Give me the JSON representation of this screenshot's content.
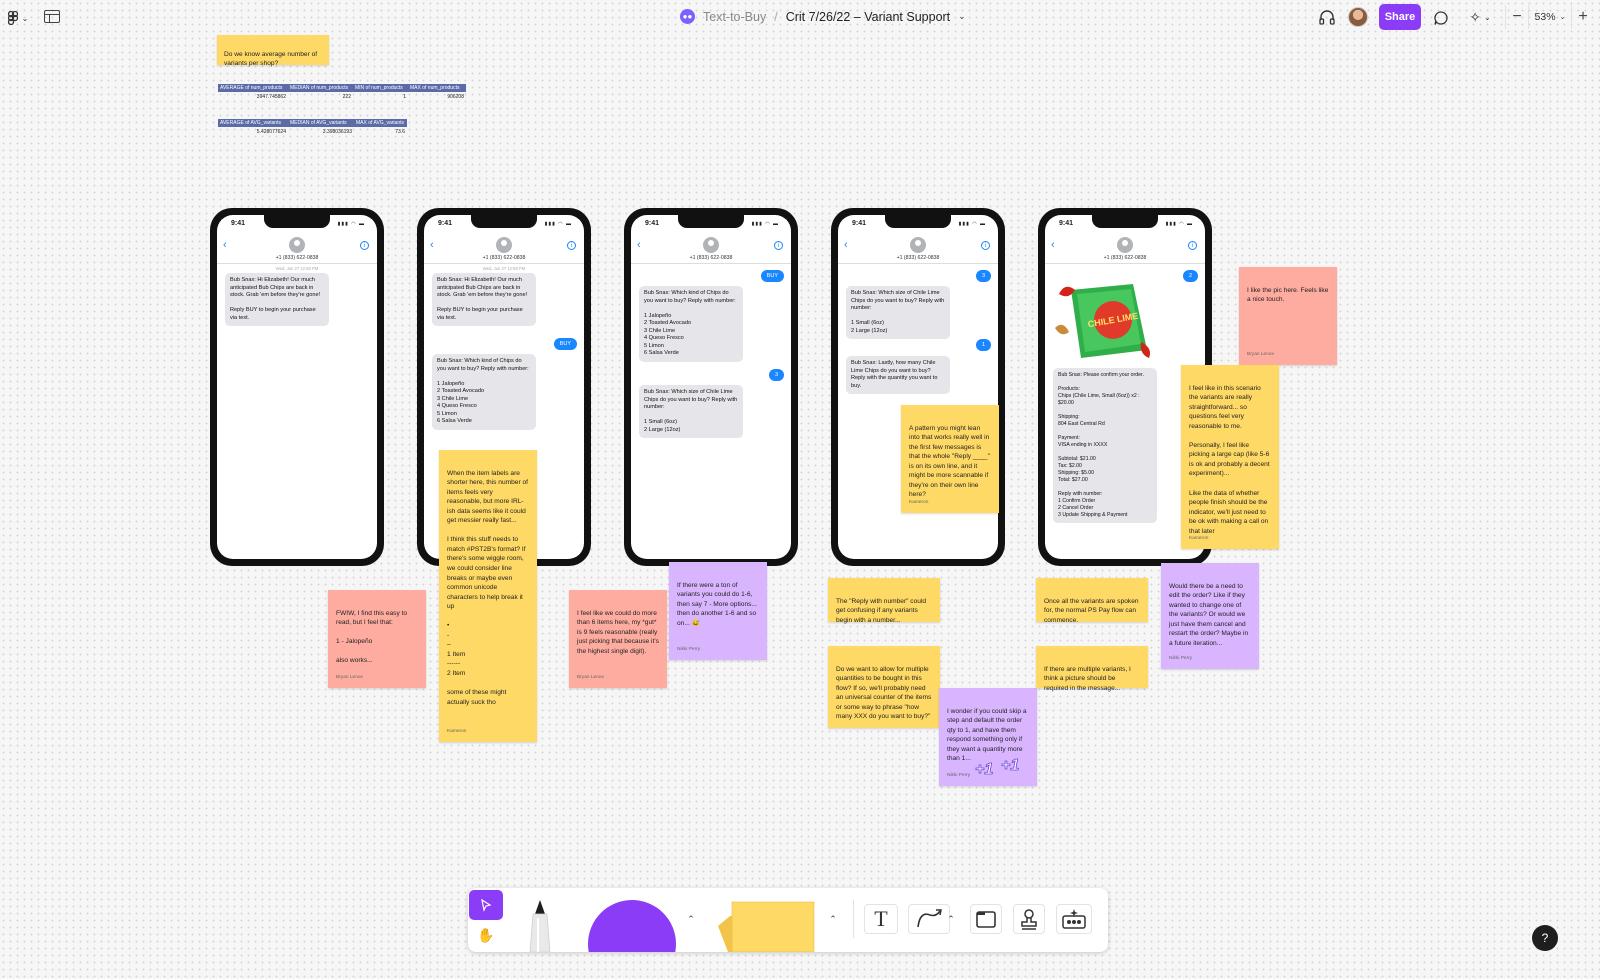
{
  "topbar": {
    "team": "Text-to-Buy",
    "separator": "/",
    "file": "Crit 7/26/22 – Variant Support",
    "share": "Share",
    "zoom": "53%",
    "zoom_minus": "−",
    "zoom_plus": "+"
  },
  "notes": {
    "question": "Do we know average number of variants per shop?",
    "fwiw": "FWIW, I find this easy to read, but I feel that:\n\n1 - Jalopeño\n\nalso works...",
    "fwiw_author": "Bryan Lenox",
    "labels_shorter": "When the item labels are shorter here, this number of items feels very reasonable, but more IRL-ish data seems like it could get messier really fast...\n\nI think this stuff needs to match #PST2B's format? If there's some wiggle room, we could consider line breaks or maybe even common unicode characters to help break it up\n\n•\n-\n–\n1 Item\n------\n2 Item\n\n   some of these might actually suck tho",
    "labels_author": "Kameron",
    "more_than_6": "I feel like we could do more than 6 items here, my *gut* is 9 feels reasonable (really just picking that because it's the highest single digit).",
    "more_than_6_author": "Bryan Lenox",
    "ton_of_variants": "If there were a ton of variants you could do 1-6, then say 7 - More options... then do another 1-6 and so on... 😅",
    "ton_author": "Nikki Perry",
    "pattern_lean": "A pattern you might lean into that works really well in the first few messages is that the whole \"Reply ____\" is on its own line, and it might be more scannable if they're on their own line here?",
    "pattern_author": "Kameron",
    "reply_confusing": "The \"Reply with number\" could get confusing if any variants begin with a number...",
    "multiple_quantities": "Do we want to allow for multiple quantities to be bought in this flow? If so, we'll probably need an universal counter of the items or some way to phrase \"how many XXX do you want to buy?\"",
    "skip_step": "I wonder if you could skip a step and default the order qty to 1, and have them respond something only if they want a quantity more than 1...",
    "skip_author": "Nikki Perry",
    "plus_one": "+1",
    "once_variants": "Once all the variants are spoken for, the normal PS Pay flow can commence.",
    "multiple_variants_pic": "If there are multiple variants, I think a picture should be required in the message...",
    "like_pic": "I like the pic here. Feels like a nice touch.",
    "like_pic_author": "Bryan Lenox",
    "straightforward": "I feel like in this scenario the variants are really straightforward... so questions feel very reasonable to me.\n\nPersonally, I feel like picking a large cap (like 5-6 is ok and probably a decent experiment)...\n\nLike the data of whether people finish should be the indicator, we'll just need to be ok with making a call on that later",
    "straightforward_author": "Kameron",
    "edit_order": "Would there be a need to edit the order? Like if they wanted to change one of the variants? Or would we just have them cancel and restart the order? Maybe in a future iteration...",
    "edit_author": "Nikki Perry"
  },
  "tables": {
    "products": {
      "headers": [
        "AVERAGE of num_products",
        "MEDIAN of num_products",
        "MIN of num_products",
        "MAX of num_products"
      ],
      "values": [
        "3947.745862",
        "222",
        "1",
        "906208"
      ]
    },
    "variants": {
      "headers": [
        "AVERAGE of AVG_variants",
        "MEDIAN of AVG_variants",
        "MAX of AVG_variants"
      ],
      "values": [
        "5.428077624",
        "3.398036193",
        "73.6"
      ]
    }
  },
  "phone_common": {
    "time": "9:41",
    "contact": "+1 (833) 622-0838",
    "timestamp": "Wed, Jun 27 12:58 PM"
  },
  "messages": {
    "intro": "Bub Snax: Hi Elizabeth! Our much anticipated Bub Chips are back in stock. Grab 'em before they're gone!\n\nReply BUY to begin your purchase via text.",
    "buy": "BUY",
    "which_kind": "Bub Snax: Which kind of Chips do you want to buy? Reply with number:\n\n1 Jalopeño\n2 Toasted Avocado\n3 Chile Lime\n4 Queso Fresco\n5 Limon\n6 Salsa Verde",
    "reply_3": "3",
    "which_size": "Bub Snax: Which size of Chile Lime Chips do you want to buy? Reply with number:\n\n1 Small (6oz)\n2 Large (12oz)",
    "reply_1": "1",
    "how_many": "Bub Snax: Lastly, how many Chile Lime Chips do you want to buy? Reply with the quantity you want to buy.",
    "reply_2": "2",
    "confirm": "Bub Snax: Please confirm your order.\n\nProducts:\nChips (Chile Lime, Small (6oz)) x2 : $20.00\n\nShipping:\n804 East Central Rd\n\nPayment:\nVISA ending in XXXX\n\nSubtotal: $21.00\nTax: $2.00\nShipping: $5.00\nTotal: $27.00\n\nReply with number:\n1 Confirm Order\n2 Cancel Order\n3 Update Shipping & Payment",
    "chips_label": "CHILE LIME"
  },
  "colors": {
    "accent": "#8b3cf6",
    "sticky_yellow": "#ffd965",
    "sticky_pink": "#ffaca0",
    "sticky_purple": "#d9b5ff",
    "imessage_blue": "#1a86ff"
  },
  "help": "?"
}
